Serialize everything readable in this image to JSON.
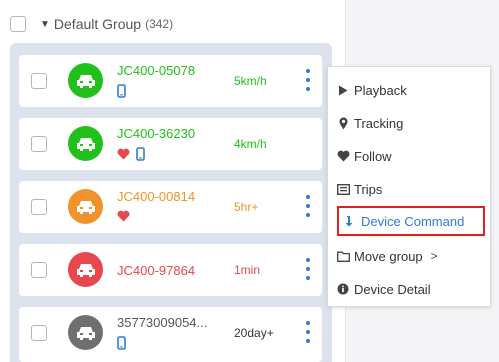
{
  "group": {
    "name": "Default Group",
    "count": "(342)"
  },
  "devices": [
    {
      "name": "JC400-05078",
      "status": "5km/h",
      "color": "#22c01a",
      "phone": true,
      "heart": false
    },
    {
      "name": "JC400-36230",
      "status": "4km/h",
      "color": "#22c01a",
      "phone": true,
      "heart": true
    },
    {
      "name": "JC400-00814",
      "status": "5hr+",
      "color": "#f0932b",
      "phone": false,
      "heart": true
    },
    {
      "name": "JC400-97864",
      "status": "1min",
      "color": "#e8474e",
      "phone": false,
      "heart": false
    },
    {
      "name": "35773009054...",
      "status": "20day+",
      "color": "#6f6f6f",
      "phone": true,
      "heart": false
    }
  ],
  "menu": {
    "playback": "Playback",
    "tracking": "Tracking",
    "follow": "Follow",
    "trips": "Trips",
    "device_command": "Device Command",
    "move_group": "Move group",
    "move_group_arrow": ">",
    "device_detail": "Device Detail"
  },
  "colors": {
    "accent": "#2f7bd8",
    "highlight_border": "#e02020"
  }
}
